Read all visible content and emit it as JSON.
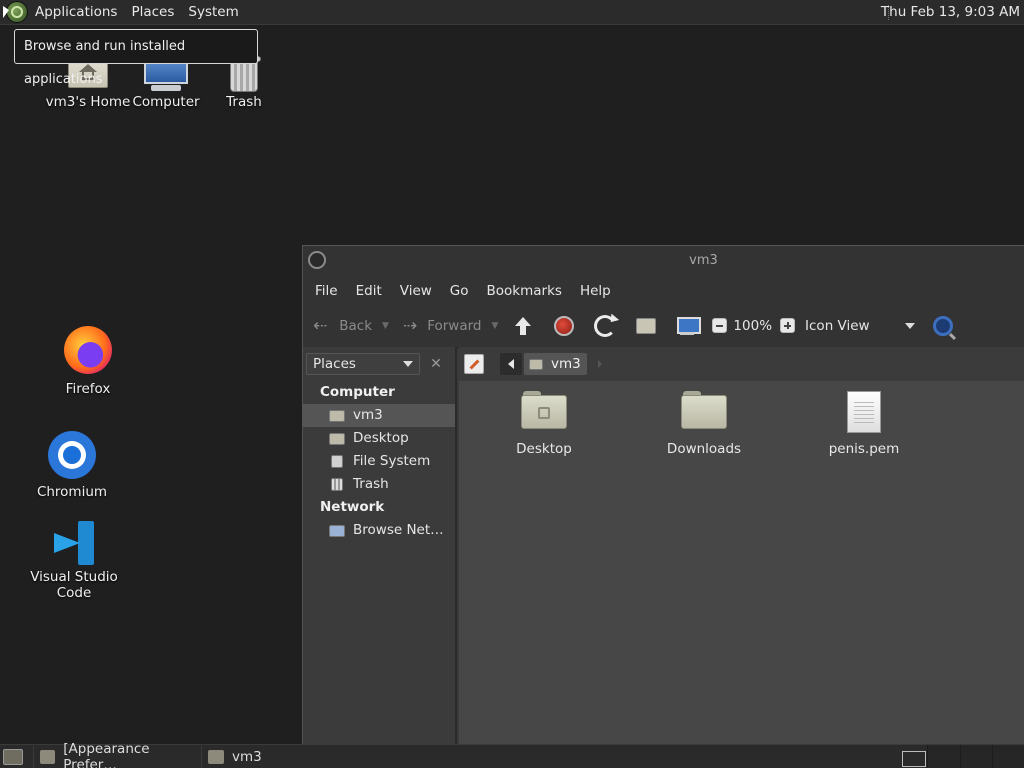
{
  "top_panel": {
    "menus": [
      "Applications",
      "Places",
      "System"
    ],
    "clock": "Thu Feb 13,  9:03 AM"
  },
  "tooltip": "Browse and run installed applications",
  "desktop_icons": {
    "home": "vm3's Home",
    "computer": "Computer",
    "trash": "Trash",
    "firefox": "Firefox",
    "chromium": "Chromium",
    "vscode": "Visual Studio Code"
  },
  "window": {
    "title": "vm3",
    "menus": [
      "File",
      "Edit",
      "View",
      "Go",
      "Bookmarks",
      "Help"
    ],
    "toolbar": {
      "back": "Back",
      "forward": "Forward",
      "zoom": "100%",
      "view_mode": "Icon View"
    },
    "sidebar": {
      "selector": "Places",
      "groups": [
        {
          "title": "Computer",
          "items": [
            "vm3",
            "Desktop",
            "File System",
            "Trash"
          ]
        },
        {
          "title": "Network",
          "items": [
            "Browse Net…"
          ]
        }
      ]
    },
    "pathbar": {
      "current": "vm3"
    },
    "files": [
      "Desktop",
      "Downloads",
      "penis.pem"
    ]
  },
  "taskbar": {
    "tasks": [
      "[Appearance Prefer…",
      "vm3"
    ]
  }
}
